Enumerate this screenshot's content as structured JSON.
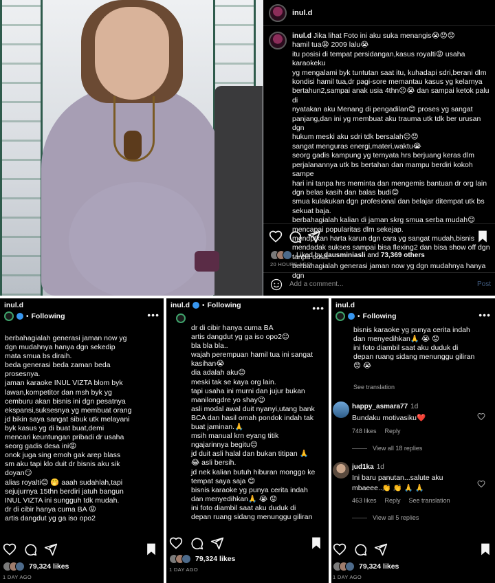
{
  "post": {
    "username": "inul.d",
    "caption_lines": [
      "Jika lihat Foto ini aku suka menangis😭😟😟",
      "hamil tua😩 2009 lalu😭",
      "itu posisi di tempat persidangan,kasus royalti😡 usaha karaokeku",
      "yg mengalami byk tuntutan saat itu, kuhadapi sdri,berani dlm",
      "kondisi hamil tua,dr pagi-sore memantau kasus yg kelarnya",
      "bertahun2,sampai anak usia 4thn😣😭 dan sampai ketok palu di",
      "nyatakan aku Menang di pengadilan😊 proses yg sangat",
      "panjang,dan ini yg membuat aku trauma utk tdk ber urusan dgn",
      "hukum meski aku sdri tdk bersalah😣😟",
      "sangat menguras energi,materi,waktu😭",
      "seorg gadis kampung yg ternyata hrs berjuang keras dlm",
      "perjalanannya utk bs bertahan dan mampu berdiri kokoh sampe",
      "hari ini tanpa hrs meminta dan mengemis bantuan dr org lain",
      "dgn belas kasih dan balas budi😊",
      "smua kulakukan dgn profesional dan belajar ditempat utk bs",
      "sekuat baja.",
      "berbahagialah kalian di jaman skrg smua serba mudah😊",
      "mencapai popularitas dlm sekejap.",
      "mendptkan harta karun dgn cara yg sangat mudah,bisnis",
      "mendadak sukses sampai bisa flexing2 dan bisa show off dgn",
      "tanpa dosa.",
      "berbahagialah generasi jaman now yg dgn mudahnya hanya dgn"
    ],
    "liked_by": "dausminiasli",
    "likes_count": "73,369 others",
    "liked_prefix": "Liked by",
    "liked_mid": "and",
    "time": "20 HOURS AGO",
    "comment_placeholder": "Add a comment...",
    "post_label": "Post"
  },
  "panel1": {
    "username": "inul.d",
    "following": "Following",
    "lines": [
      "berbahagialah generasi jaman now yg",
      "dgn mudahnya hanya dgn sekedip",
      "mata smua bs diraih.",
      "beda generasi beda zaman beda",
      "prosesnya.",
      "jaman karaoke INUL VIZTA blom byk",
      "lawan,kompetitor dan msh byk yg",
      "cemburu akan bisnis ini dgn pesatnya",
      "ekspansi,suksesnya yg membuat orang",
      "jd bikin saya sangat sibuk utk melayani",
      "byk kasus yg di buat buat,demi",
      "mencari keuntungan pribadi dr usaha",
      "seorg gadis desa ini😡",
      "onok juga sing emoh gak arep blass",
      "sm aku tapi klo duit dr bisnis aku sik",
      "doyan😏",
      "alias royalti😊 🤭 aaah sudahlah,tapi",
      "sejujurnya 15thn berdiri jatuh bangun",
      "INUL VIZTA ini sungguh tdk mudah.",
      "dr di cibir hanya cuma BA 😝",
      "artis dangdut yg ga iso opo2"
    ],
    "likes": "79,324 likes",
    "time": "1 DAY AGO"
  },
  "panel2": {
    "username": "inul.d",
    "following": "Following",
    "lines": [
      "dr di cibir hanya cuma BA",
      "artis dangdut yg ga iso opo2😊",
      "bla bla bla..",
      "wajah perempuan hamil tua ini sangat",
      "kasihan😭",
      "dia adalah aku😊",
      "meski tak se kaya org lain.",
      "tapi usaha ini murni dan jujur bukan",
      "manilongdre yo shay😉",
      "asli modal awal duit nyanyi,utang bank",
      "BCA dan hasil omah pondok indah tak",
      "buat jaminan.🙏",
      "msih manual krn eyang titik",
      "ngajarinnya begitu😊",
      "jd duit asli halal dan bukan titipan 🙏",
      "😂 asli bersih.",
      "jd nek kalian butuh hiburan monggo ke",
      "tempat saya saja 😊",
      "bisnis karaoke yg punya cerita indah",
      "dan menyedihkan🙏 😭 😟",
      "ini foto diambil saat aku duduk di",
      "depan ruang sidang menunggu giliran"
    ],
    "likes": "79,324 likes",
    "time": "1 DAY AGO"
  },
  "panel3": {
    "username": "inul.d",
    "following": "Following",
    "lines": [
      "bisnis karaoke yg punya cerita indah",
      "dan menyedihkan🙏 😭 😟",
      "ini foto diambil saat aku duduk di",
      "depan ruang sidang menunggu giliran",
      "😟 😭"
    ],
    "see_translation": "See translation",
    "comments": [
      {
        "user": "happy_asmara77",
        "age": "1d",
        "text": "Bundaku motivasiku❤️",
        "likes": "748 likes",
        "reply": "Reply",
        "view": "View all 18 replies"
      },
      {
        "user": "jud1ka",
        "age": "1d",
        "text": "Ini baru panutan...salute aku",
        "text2": "mbaeee..👏 👏 🙏 🙏",
        "likes": "463 likes",
        "reply": "Reply",
        "see": "See translation",
        "view": "View all 5 replies"
      }
    ],
    "likes": "79,324 likes",
    "time": "1 DAY AGO"
  },
  "colors": {
    "bg": "#000000",
    "text": "#f5f5f5",
    "muted": "#a8a8a8",
    "verified": "#3897f0"
  },
  "icons": [
    "heart-icon",
    "comment-icon",
    "share-icon",
    "bookmark-icon",
    "more-icon",
    "smiley-icon",
    "verified-icon"
  ]
}
